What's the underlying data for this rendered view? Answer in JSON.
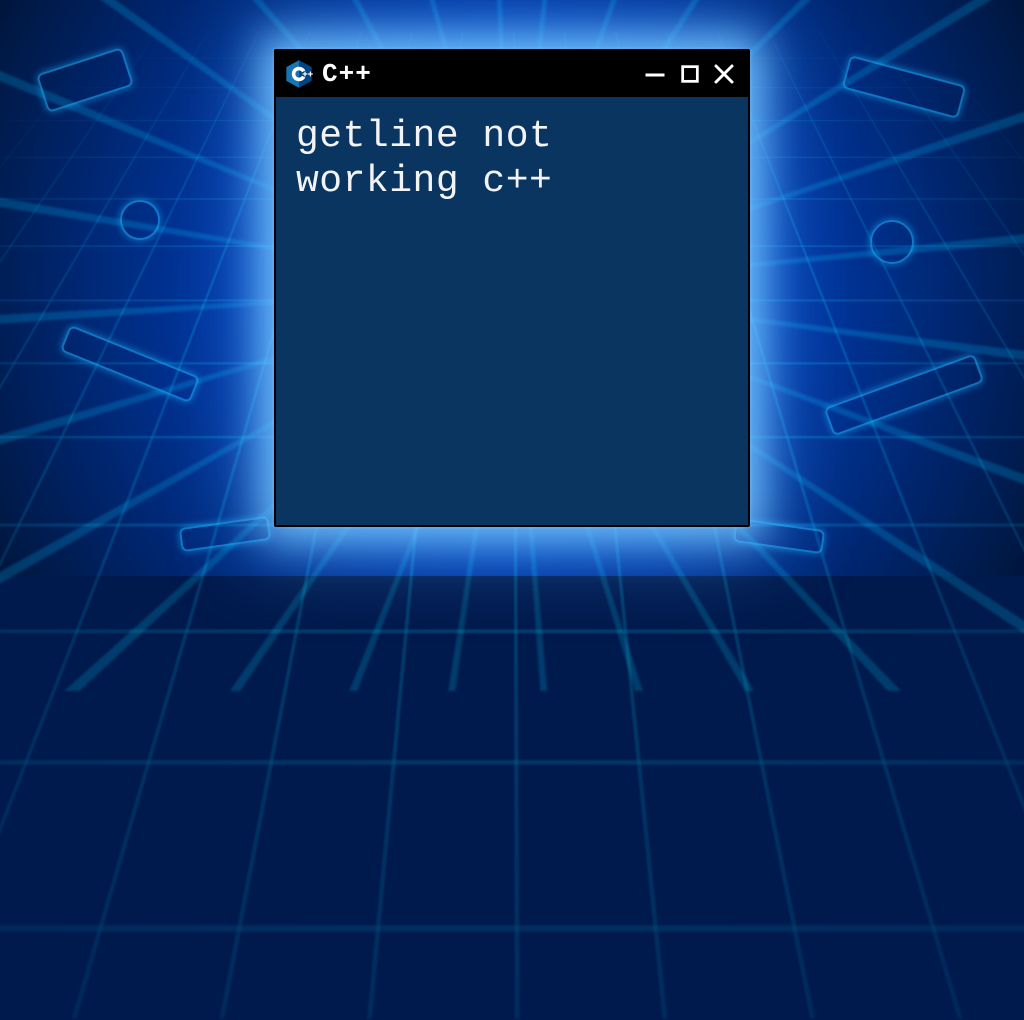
{
  "window": {
    "title": "C++",
    "content": "getline not\nworking c++",
    "icon_name": "cpp-logo-icon"
  },
  "colors": {
    "window_bg": "#0a3560",
    "titlebar_bg": "#000000",
    "text": "#f2f3f4",
    "glow": "#5cc3ff"
  }
}
